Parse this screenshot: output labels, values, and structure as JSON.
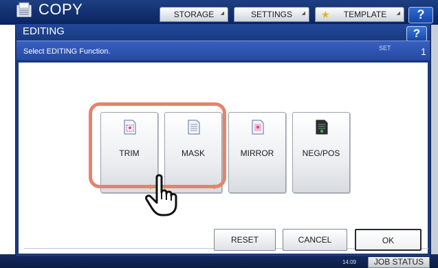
{
  "app": {
    "title": "COPY",
    "help_label": "?"
  },
  "top_tabs": [
    {
      "label": "STORAGE"
    },
    {
      "label": "SETTINGS"
    },
    {
      "label": "TEMPLATE"
    }
  ],
  "dialog": {
    "title": "EDITING",
    "help_label": "?",
    "subtitle": "Select EDITING Function.",
    "set_label": "SET",
    "set_value": "1"
  },
  "functions": [
    {
      "label": "TRIM",
      "icon": "trim-icon"
    },
    {
      "label": "MASK",
      "icon": "mask-icon"
    },
    {
      "label": "MIRROR",
      "icon": "mirror-icon"
    },
    {
      "label": "NEG/POS",
      "icon": "negpos-icon"
    }
  ],
  "buttons": {
    "reset": "RESET",
    "cancel": "CANCEL",
    "ok": "OK"
  },
  "footer": {
    "time": "14:09",
    "job_status": "JOB STATUS"
  },
  "colors": {
    "header_blue": "#1c3b7c",
    "highlight": "#e8826a"
  }
}
